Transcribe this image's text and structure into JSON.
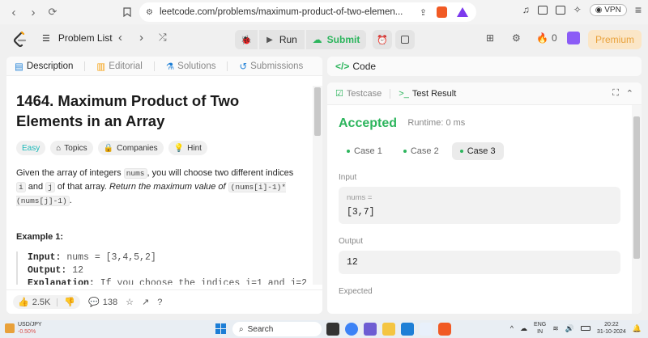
{
  "browser": {
    "url": "leetcode.com/problems/maximum-product-of-two-elemen...",
    "vpn_label": "VPN",
    "brave_badge": "1"
  },
  "nav": {
    "problem_list": "Problem List",
    "run": "Run",
    "submit": "Submit",
    "streak_count": "0",
    "premium": "Premium"
  },
  "left_tabs": [
    "Description",
    "Editorial",
    "Solutions",
    "Submissions"
  ],
  "problem": {
    "title": "1464. Maximum Product of Two Elements in an Array",
    "difficulty": "Easy",
    "badges": [
      "Topics",
      "Companies",
      "Hint"
    ],
    "desc_1": "Given the array of integers ",
    "desc_nums": "nums",
    "desc_2": ", you will choose two different indices ",
    "desc_i": "i",
    "desc_3": " and ",
    "desc_j": "j",
    "desc_4": " of that array. ",
    "desc_italic": "Return the maximum value of",
    "desc_expr": "(nums[i]-1)*(nums[j]-1)",
    "desc_end": ".",
    "example_title": "Example 1:",
    "input_label": "Input:",
    "input_value": "nums = [3,4,5,2]",
    "output_label": "Output:",
    "output_value": "12",
    "explanation_label": "Explanation:",
    "explanation_value": "If you choose the indices i=1 and j=2"
  },
  "footer": {
    "likes": "2.5K",
    "comments": "138"
  },
  "code_panel": {
    "title": "Code"
  },
  "result_tabs": [
    "Testcase",
    "Test Result"
  ],
  "result": {
    "status": "Accepted",
    "runtime": "Runtime: 0 ms",
    "cases": [
      "Case 1",
      "Case 2",
      "Case 3"
    ],
    "input_label": "Input",
    "input_var": "nums =",
    "input_value": "[3,7]",
    "output_label": "Output",
    "output_value": "12",
    "expected_label": "Expected"
  },
  "taskbar": {
    "stock_name": "USD/JPY",
    "stock_change": "-0.50%",
    "search": "Search",
    "lang_top": "ENG",
    "lang_bottom": "IN",
    "time": "20:22",
    "date": "31-10-2024"
  },
  "colors": {
    "accepted": "#2db55d",
    "easy": "#1cb8b8",
    "premium_bg": "#fbe6c7",
    "premium_text": "#e8a13b",
    "submit": "#2db55d"
  }
}
